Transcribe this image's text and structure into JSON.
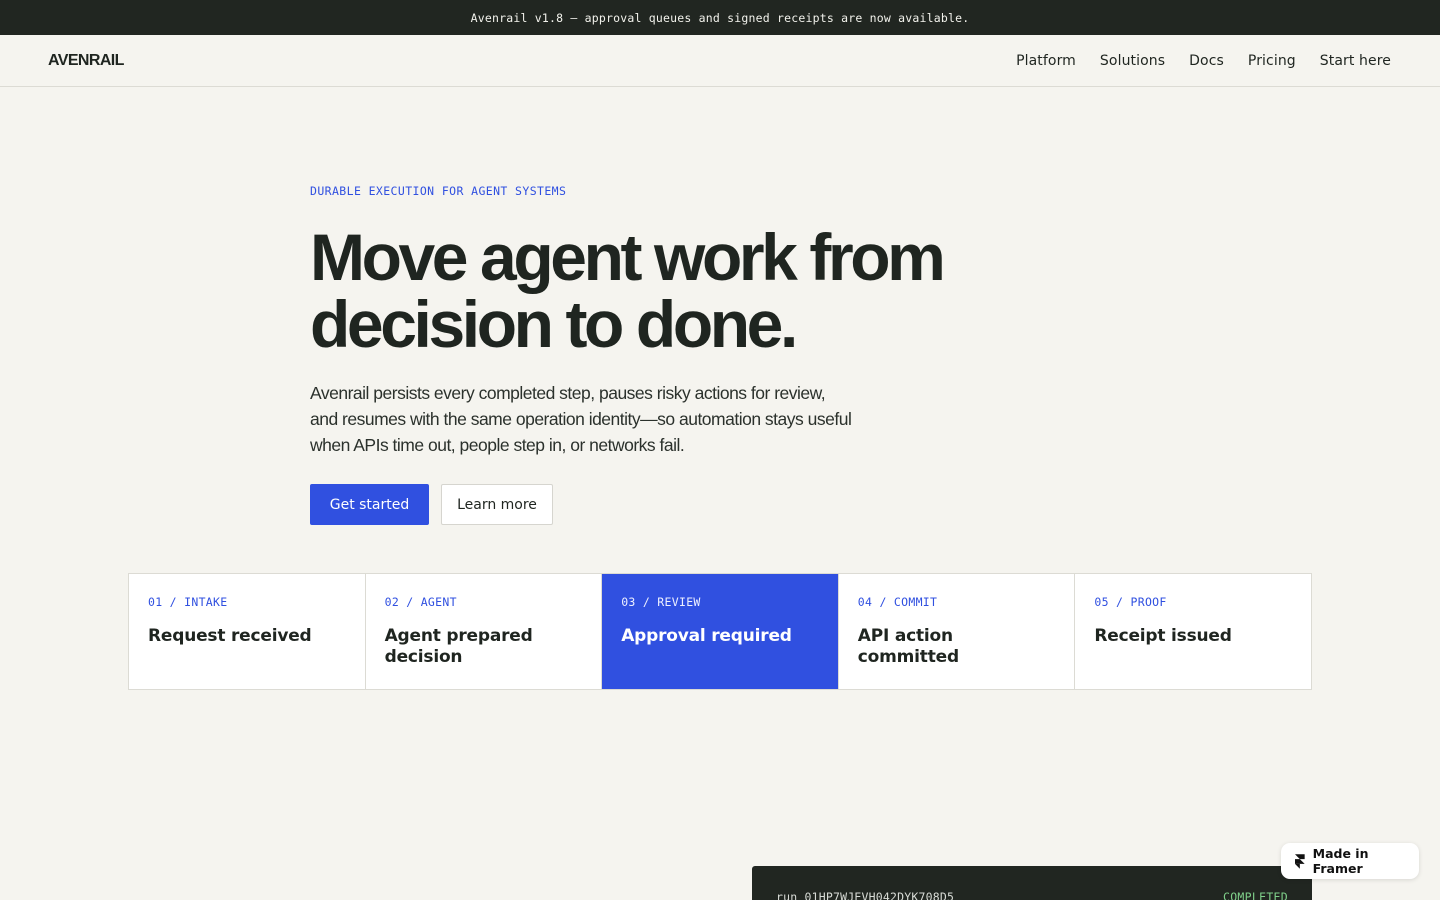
{
  "announcement": "Avenrail v1.8 — approval queues and signed receipts are now available.",
  "nav": {
    "logo": "AVENRAIL",
    "links": [
      "Platform",
      "Solutions",
      "Docs",
      "Pricing",
      "Start here"
    ]
  },
  "hero": {
    "eyebrow": "DURABLE EXECUTION FOR AGENT SYSTEMS",
    "headline": "Move agent work from decision to done.",
    "subhead": "Avenrail persists every completed step, pauses risky actions for review, and resumes with the same operation identity—so automation stays useful when APIs time out, people step in, or networks fail.",
    "primary_cta": "Get started",
    "secondary_cta": "Learn more"
  },
  "steps": [
    {
      "tag": "01 / INTAKE",
      "title": "Request received",
      "active": false
    },
    {
      "tag": "02 / AGENT",
      "title": "Agent prepared decision",
      "active": false
    },
    {
      "tag": "03 / REVIEW",
      "title": "Approval required",
      "active": true
    },
    {
      "tag": "04 / COMMIT",
      "title": "API action committed",
      "active": false
    },
    {
      "tag": "05 / PROOF",
      "title": "Receipt issued",
      "active": false
    }
  ],
  "console": {
    "run_id": "run_01HP7WJEVH042DYK708D5",
    "status": "COMPLETED"
  },
  "badge": {
    "label": "Made in Framer",
    "icon": "framer-icon"
  },
  "colors": {
    "accent": "#3050e0",
    "dark": "#212621",
    "background": "#f5f4ef",
    "status_ok": "#7fd08a"
  }
}
